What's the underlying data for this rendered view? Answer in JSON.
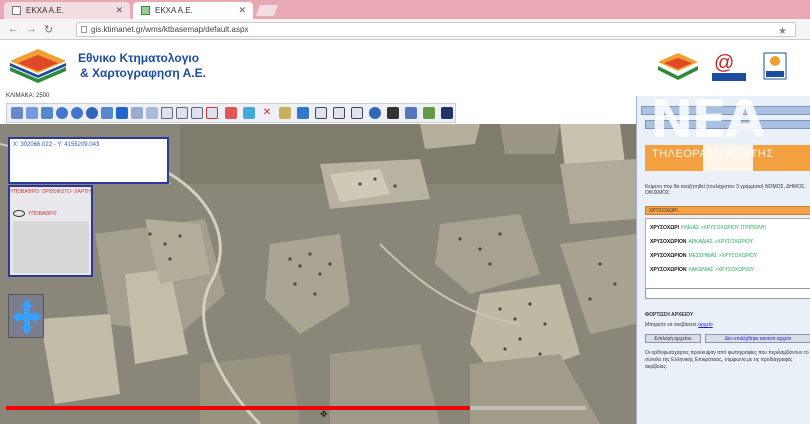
{
  "browser": {
    "tabs": [
      {
        "label": "ΕΚΧΑ Α.Ε."
      },
      {
        "label": "ΕΚΧΑ Α.Ε."
      }
    ],
    "url": "gis.ktimanet.gr/wms/ktbasemap/default.aspx"
  },
  "header": {
    "title_line1": "Εθνικο Κτηματολογιο",
    "title_line2": "& Χαρτογραφηση Α.Ε."
  },
  "map": {
    "scale_label": "ΚΛΙΜΑΚΑ: 2500",
    "coords": "X: 302066.022 - Y: 4155209.043",
    "layers_title": "ΥΠΟΒΑΘΡΟ: ΟΡΘΟΦΩΤΟ- ΧΑΡΤΗ",
    "layer_name": "ΥΠΟΒΑΘΡΟ",
    "video_progress": 0.8
  },
  "panel": {
    "instructions": "Κείμενο που θα αναζητηθεί (τουλάχιστον 3 γράμματα) ΝΟΜΟΣ, ΔΗΜΟΣ, ΟΙΚΙΣΜΟΣ:",
    "search_value": "ΧΡΥΣΟΧΩΡΙ",
    "results": [
      {
        "name": "ΧΡΥΣΟΧΩΡΙ",
        "detail": "ΗΛΕΙΑΣ >ΧΡΥΣΟΧΩΡΙΟΥ (ΤΡΙΠΟΛΗ)"
      },
      {
        "name": "ΧΡΥΣΟΧΩΡΙΟΝ",
        "detail": "ΑΡΚΑΔΙΑΣ >ΧΡΥΣΟΧΩΡΙΟΥ"
      },
      {
        "name": "ΧΡΥΣΟΧΩΡΙΟΝ",
        "detail": "ΜΕΣΣΗΝΙΑΣ >ΧΡΥΣΟΧΩΡΙΟΥ"
      },
      {
        "name": "ΧΡΥΣΟΧΩΡΙΟΝ",
        "detail": "ΛΑΚΩΝΙΑΣ >ΧΡΥΣΟΧΩΡΙΟΥ"
      }
    ],
    "upload_title": "ΦΟΡΤΩΣΗ ΑΡΧΕΙΟΥ",
    "upload_text": "Μπορείτε να ανεβάσετε",
    "upload_link": "αρχείο",
    "browse_button": "Επιλογή αρχείου",
    "no_file": "Δεν επιλέχθηκε κανένα αρχείο",
    "description": "Οι ορθοφωτοχάρτες προέκυψαν από φωτογραφίες που περιλαμβάνουν το σύνολο της Ελληνικής Επικράτειας, σύμφωνα με τις προδιαγραφές ακρίβειας."
  },
  "watermark": {
    "logo": "NEA",
    "caption": "ΤΗΛΕΟΡΑΣΗ ΚΡΗΤΗΣ"
  },
  "colors": {
    "brand_blue": "#1d4b9e",
    "panel_orange": "#f2a040",
    "progress_red": "#ee0000"
  }
}
